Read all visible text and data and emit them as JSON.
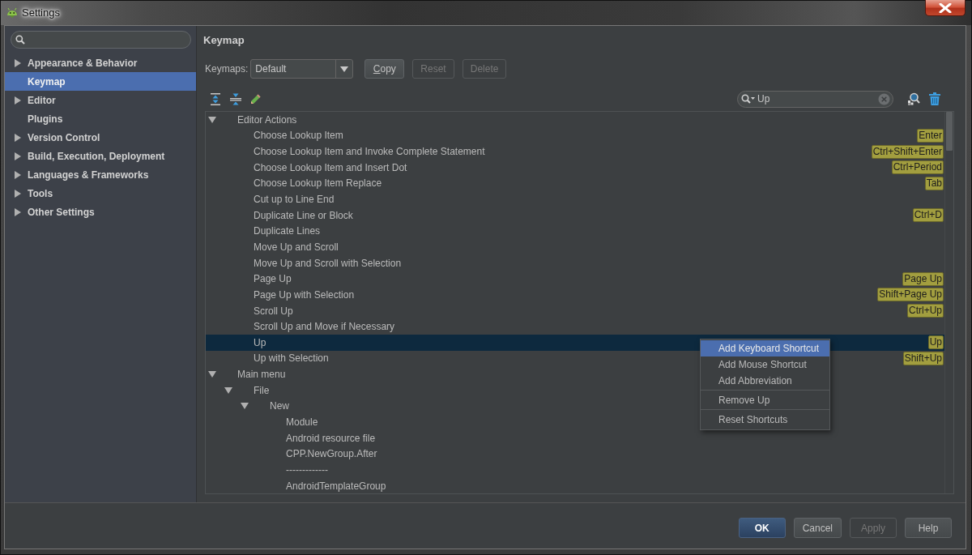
{
  "window": {
    "title": "Settings"
  },
  "sidebar": {
    "items": [
      {
        "label": "Appearance & Behavior",
        "expandable": true,
        "selected": false
      },
      {
        "label": "Keymap",
        "expandable": false,
        "selected": true
      },
      {
        "label": "Editor",
        "expandable": true,
        "selected": false
      },
      {
        "label": "Plugins",
        "expandable": false,
        "selected": false
      },
      {
        "label": "Version Control",
        "expandable": true,
        "selected": false
      },
      {
        "label": "Build, Execution, Deployment",
        "expandable": true,
        "selected": false
      },
      {
        "label": "Languages & Frameworks",
        "expandable": true,
        "selected": false
      },
      {
        "label": "Tools",
        "expandable": true,
        "selected": false
      },
      {
        "label": "Other Settings",
        "expandable": true,
        "selected": false
      }
    ]
  },
  "panel": {
    "title": "Keymap",
    "keymaps": {
      "label": "Keymaps:",
      "value": "Default"
    },
    "buttons": [
      {
        "label": "Copy",
        "disabled": false,
        "mnemonic": true
      },
      {
        "label": "Reset",
        "disabled": true,
        "mnemonic": false
      },
      {
        "label": "Delete",
        "disabled": true,
        "mnemonic": false
      }
    ],
    "filter": {
      "value": "Up"
    },
    "tree": [
      {
        "label": "Editor Actions",
        "expanded": true,
        "selected": false,
        "children": [
          {
            "label": "Choose Lookup Item",
            "selected": false,
            "shortcuts": [
              "Enter"
            ]
          },
          {
            "label": "Choose Lookup Item and Invoke Complete Statement",
            "selected": false,
            "shortcuts": [
              "Ctrl+Shift+Enter"
            ]
          },
          {
            "label": "Choose Lookup Item and Insert Dot",
            "selected": false,
            "shortcuts": [
              "Ctrl+Period"
            ]
          },
          {
            "label": "Choose Lookup Item Replace",
            "selected": false,
            "shortcuts": [
              "Tab"
            ]
          },
          {
            "label": "Cut up to Line End",
            "selected": false
          },
          {
            "label": "Duplicate Line or Block",
            "selected": false,
            "shortcuts": [
              "Ctrl+D"
            ]
          },
          {
            "label": "Duplicate Lines",
            "selected": false
          },
          {
            "label": "Move Up and Scroll",
            "selected": false
          },
          {
            "label": "Move Up and Scroll with Selection",
            "selected": false
          },
          {
            "label": "Page Up",
            "selected": false,
            "shortcuts": [
              "Page Up"
            ]
          },
          {
            "label": "Page Up with Selection",
            "selected": false,
            "shortcuts": [
              "Shift+Page Up"
            ]
          },
          {
            "label": "Scroll Up",
            "selected": false,
            "shortcuts": [
              "Ctrl+Up"
            ]
          },
          {
            "label": "Scroll Up and Move if Necessary",
            "selected": false
          },
          {
            "label": "Up",
            "selected": true,
            "shortcuts": [
              "Up"
            ]
          },
          {
            "label": "Up with Selection",
            "selected": false,
            "shortcuts": [
              "Shift+Up"
            ]
          }
        ]
      },
      {
        "label": "Main menu",
        "expanded": true,
        "selected": false,
        "children": [
          {
            "label": "File",
            "expanded": true,
            "selected": false,
            "children": [
              {
                "label": "New",
                "expanded": true,
                "selected": false,
                "children": [
                  {
                    "label": "Module",
                    "selected": false
                  },
                  {
                    "label": "Android resource file",
                    "selected": false
                  },
                  {
                    "label": "CPP.NewGroup.After",
                    "selected": false
                  },
                  {
                    "label": "-------------",
                    "selected": false
                  },
                  {
                    "label": "AndroidTemplateGroup",
                    "selected": false
                  }
                ]
              }
            ]
          }
        ]
      }
    ],
    "context_menu": {
      "groups": [
        {
          "items": [
            {
              "label": "Add Keyboard Shortcut",
              "selected": true
            },
            {
              "label": "Add Mouse Shortcut",
              "selected": false
            },
            {
              "label": "Add Abbreviation",
              "selected": false
            }
          ]
        },
        {
          "items": [
            {
              "label": "Remove Up",
              "selected": false
            }
          ]
        },
        {
          "items": [
            {
              "label": "Reset Shortcuts",
              "selected": false
            }
          ]
        }
      ]
    }
  },
  "dialog_buttons": [
    {
      "label": "OK",
      "default": true,
      "disabled": false
    },
    {
      "label": "Cancel",
      "default": false,
      "disabled": false
    },
    {
      "label": "Apply",
      "default": false,
      "disabled": true
    },
    {
      "label": "Help",
      "default": false,
      "disabled": false
    }
  ]
}
